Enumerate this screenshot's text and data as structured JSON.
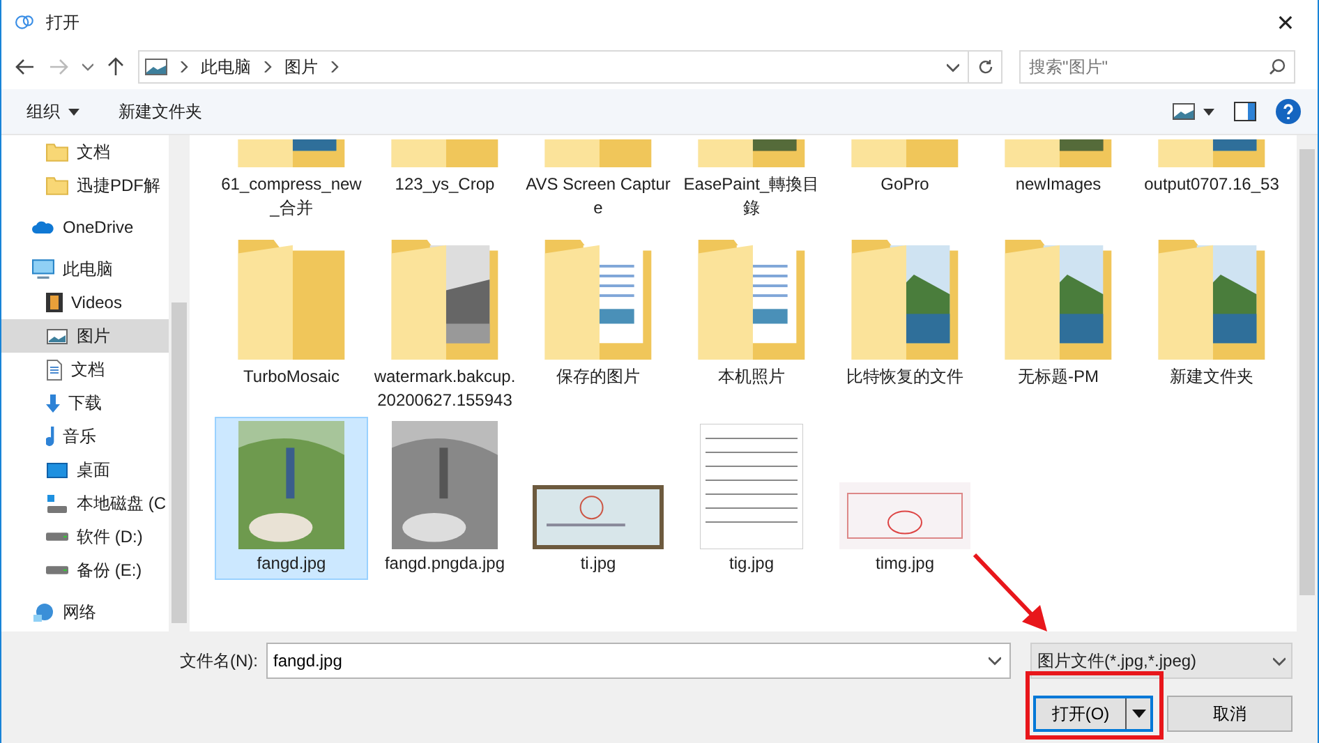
{
  "window": {
    "title": "打开",
    "close": "✕"
  },
  "nav": {
    "back_disabled": false,
    "forward_disabled": true,
    "breadcrumbs": [
      "此电脑",
      "图片"
    ],
    "search": {
      "placeholder": "搜索\"图片\""
    }
  },
  "toolbar": {
    "organize": "组织",
    "new_folder": "新建文件夹"
  },
  "sidebar": {
    "scrolled_children": [
      {
        "label": "文档",
        "selected": false
      },
      {
        "label": "迅捷PDF解",
        "selected": false
      }
    ],
    "items": [
      {
        "label": "OneDrive",
        "selected": false
      },
      {
        "label": "此电脑",
        "selected": false,
        "children": [
          {
            "label": "Videos",
            "selected": false
          },
          {
            "label": "图片",
            "selected": true
          },
          {
            "label": "文档",
            "selected": false
          },
          {
            "label": "下载",
            "selected": false
          },
          {
            "label": "音乐",
            "selected": false
          },
          {
            "label": "桌面",
            "selected": false
          },
          {
            "label": "本地磁盘 (C",
            "selected": false
          },
          {
            "label": "软件 (D:)",
            "selected": false
          },
          {
            "label": "备份 (E:)",
            "selected": false
          }
        ]
      },
      {
        "label": "网络",
        "selected": false
      }
    ]
  },
  "rows": [
    {
      "items": [
        {
          "name": "61_compress_new_合并",
          "kind": "folder",
          "selected": false
        },
        {
          "name": "123_ys_Crop",
          "kind": "folder",
          "selected": false
        },
        {
          "name": "AVS Screen Capture",
          "kind": "folder",
          "selected": false
        },
        {
          "name": "EasePaint_轉換目錄",
          "kind": "folder",
          "selected": false
        },
        {
          "name": "GoPro",
          "kind": "folder",
          "selected": false
        },
        {
          "name": "newImages",
          "kind": "folder",
          "selected": false
        },
        {
          "name": "output0707.16_53",
          "kind": "folder",
          "selected": false
        }
      ]
    },
    {
      "items": [
        {
          "name": "TurboMosaic",
          "kind": "folder",
          "selected": false
        },
        {
          "name": "watermark.bakcup.20200627.155943",
          "kind": "folder",
          "selected": false
        },
        {
          "name": "保存的图片",
          "kind": "folder",
          "selected": false
        },
        {
          "name": "本机照片",
          "kind": "folder",
          "selected": false
        },
        {
          "name": "比特恢复的文件",
          "kind": "folder",
          "selected": false
        },
        {
          "name": "无标题-PM",
          "kind": "folder",
          "selected": false
        },
        {
          "name": "新建文件夹",
          "kind": "folder",
          "selected": false
        }
      ]
    },
    {
      "items": [
        {
          "name": "fangd.jpg",
          "selected": true
        },
        {
          "name": "fangd.pngda.jpg",
          "selected": false
        },
        {
          "name": "ti.jpg",
          "selected": false
        },
        {
          "name": "tig.jpg",
          "selected": false
        },
        {
          "name": "timg.jpg",
          "selected": false
        }
      ]
    }
  ],
  "footer": {
    "filename_label": "文件名(N):",
    "filename": "fangd.jpg",
    "filetype": "图片文件(*.jpg,*.jpeg)",
    "open": "打开(O)",
    "cancel": "取消"
  },
  "annotations": {
    "highlight_open": true,
    "arrow_to_filetype": true
  }
}
